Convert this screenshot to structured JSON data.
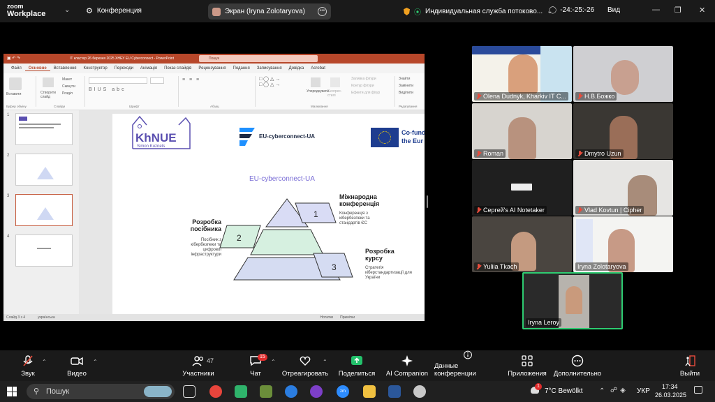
{
  "zoom": {
    "logo_line1": "zoom",
    "logo_line2": "Workplace",
    "meeting_title": "Конференция",
    "share_label": "Экран (Iryna Zolotaryova)",
    "recording_label": "Индивидуальная служба потоково...",
    "timer": "-24:-25:-26",
    "view_label": "Вид"
  },
  "ppt": {
    "doc_title": "IT кластер 26 березня 2025 ХНЕУ EU Cyberconnect - PowerPoint",
    "search_placeholder": "Пошук",
    "tabs": [
      "Файл",
      "Основне",
      "Вставлення",
      "Конструктор",
      "Переходи",
      "Анімація",
      "Показ слайдів",
      "Рецензування",
      "Подання",
      "Записування",
      "Довідка",
      "Acrobat"
    ],
    "active_tab": "Основне",
    "ribbon": {
      "paste": "Вставити",
      "create_slide": "Створити слайд",
      "layout": "Макет",
      "reset": "Скинути",
      "section": "Розділ",
      "drawing": "Упорядкувати",
      "quick_styles": "Експрес-стилі",
      "fill": "Заливка фігури",
      "outline": "Контур фігури",
      "effects": "Ефекти для фігур",
      "find": "Знайти",
      "replace": "Замінити",
      "select": "Виділити",
      "groups": [
        "Буфер обміну",
        "Слайди",
        "Шрифт",
        "Абзац",
        "Малювання",
        "Редагування"
      ]
    },
    "thumbnails": [
      "1",
      "2",
      "3",
      "4"
    ],
    "selected_thumb": "3",
    "status_left": "Слайд 3 з 4",
    "status_lang": "українська",
    "status_notes": "Нотатки",
    "status_comments": "Примітки",
    "slide": {
      "khnue_logo": "KhNUE",
      "khnue_sub": "Simon Kuznets",
      "eu_logo_text": "EU-cyberconnect-UA",
      "cofund_line1": "Co-fund",
      "cofund_line2": "the Eur",
      "heading": "EU-cyberconnect-UA",
      "item1_title": "Міжнародна конференція",
      "item1_desc": "Конференція з кібербезпеки та стандартів ЄС",
      "item2_title": "Розробка посібника",
      "item2_desc": "Посібник з кібербезпеки та цифрової інфраструктури",
      "item3_title": "Розробка курсу",
      "item3_desc": "Стратегія кіберстандартизації для України",
      "num1": "1",
      "num2": "2",
      "num3": "3"
    }
  },
  "participants": [
    {
      "name": "Olena Dudnyk, Kharkiv IT C...",
      "muted": true
    },
    {
      "name": "Н.В.Божко",
      "muted": true
    },
    {
      "name": "Roman",
      "muted": true
    },
    {
      "name": "Dmytro Uzun",
      "muted": true
    },
    {
      "name": "Сергей's AI Notetaker",
      "muted": true
    },
    {
      "name": "Vlad Kovtun | Cipher",
      "muted": true
    },
    {
      "name": "Yuliia Tkach",
      "muted": true
    },
    {
      "name": "Iryna Zolotaryova",
      "muted": false
    },
    {
      "name": "Iryna Leroy",
      "muted": false
    }
  ],
  "toolbar": {
    "audio": "Звук",
    "video": "Видео",
    "participants": "Участники",
    "participants_count": "47",
    "chat": "Чат",
    "chat_badge": "15",
    "react": "Отреагировать",
    "share": "Поделиться",
    "ai_companion": "AI Companion",
    "meeting_info": "Данные конференции",
    "apps": "Приложения",
    "more": "Дополнительно",
    "leave": "Выйти"
  },
  "taskbar": {
    "search": "Пошук",
    "weather_badge": "1",
    "weather": "7°C  Bewölkt",
    "lang": "УКР",
    "time": "17:34",
    "date": "26.03.2025"
  }
}
